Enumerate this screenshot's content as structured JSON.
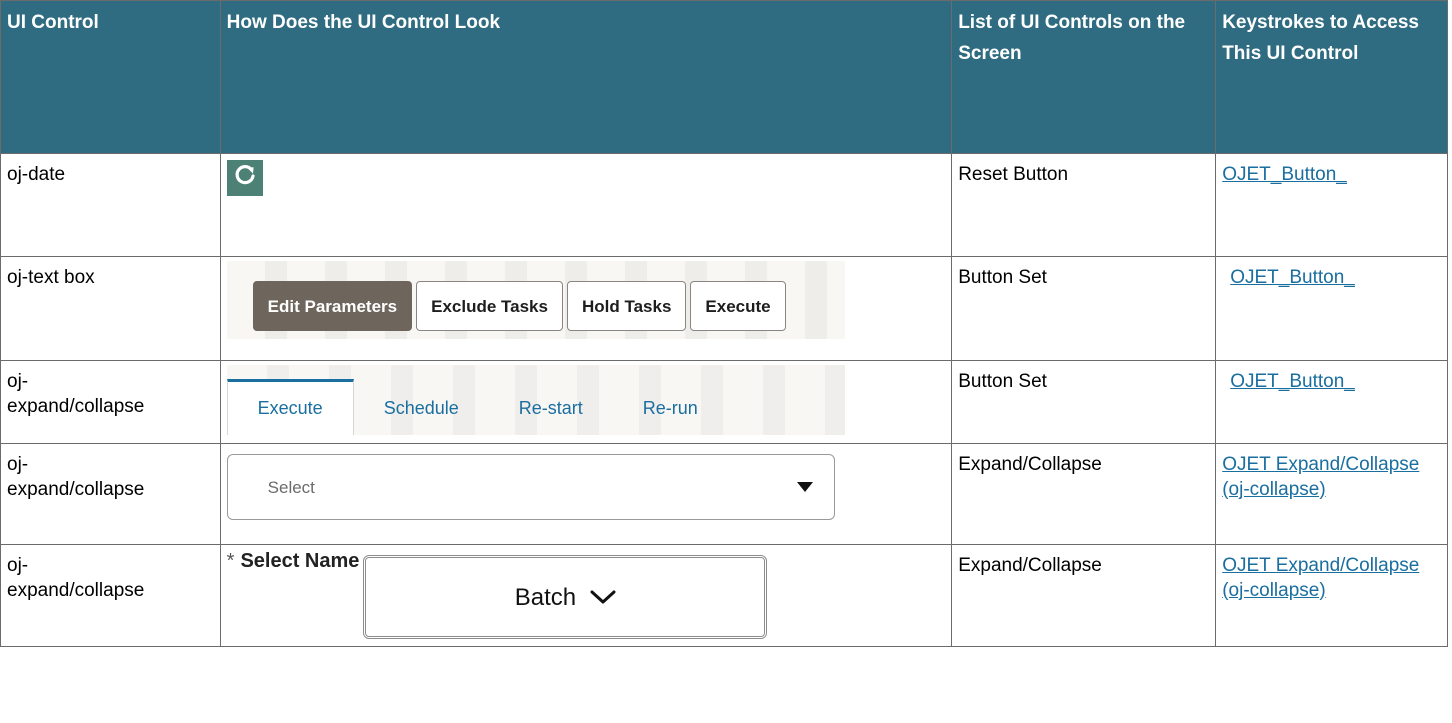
{
  "headers": {
    "col1": "UI Control",
    "col2": "How Does the UI Control Look",
    "col3": "List of UI Controls on the Screen",
    "col4": "Keystrokes to Access This UI Control"
  },
  "rows": [
    {
      "ui_control": "oj-date",
      "list": "Reset Button",
      "link": "OJET_Button_",
      "visual": {
        "icon": "refresh-icon",
        "color": "#4d8175"
      }
    },
    {
      "ui_control": "oj-text box",
      "list": "Button Set",
      "link": "OJET_Button_",
      "visual": {
        "buttons": [
          "Edit Parameters",
          "Exclude Tasks",
          "Hold Tasks",
          "Execute"
        ],
        "active_index": 0
      }
    },
    {
      "ui_control": "oj-\nexpand/collapse",
      "list": "Button Set",
      "link": "OJET_Button_",
      "visual": {
        "tabs": [
          "Execute",
          "Schedule",
          "Re-start",
          "Re-run"
        ],
        "active_index": 0
      }
    },
    {
      "ui_control": "oj-\nexpand/collapse",
      "list": "Expand/Collapse",
      "link": "OJET Expand/Collapse (oj-collapse)",
      "visual": {
        "placeholder": "Select",
        "icon": "caret-down-icon"
      }
    },
    {
      "ui_control": "oj-\nexpand/collapse",
      "list": "Expand/Collapse",
      "link": "OJET Expand/Collapse (oj-collapse)",
      "visual": {
        "required_mark": "*",
        "label": "Select Name",
        "value": "Batch",
        "icon": "chevron-down-icon"
      }
    }
  ],
  "colors": {
    "header_bg": "#2f6c81",
    "link": "#1a6ea0",
    "active_button": "#6e655d"
  }
}
